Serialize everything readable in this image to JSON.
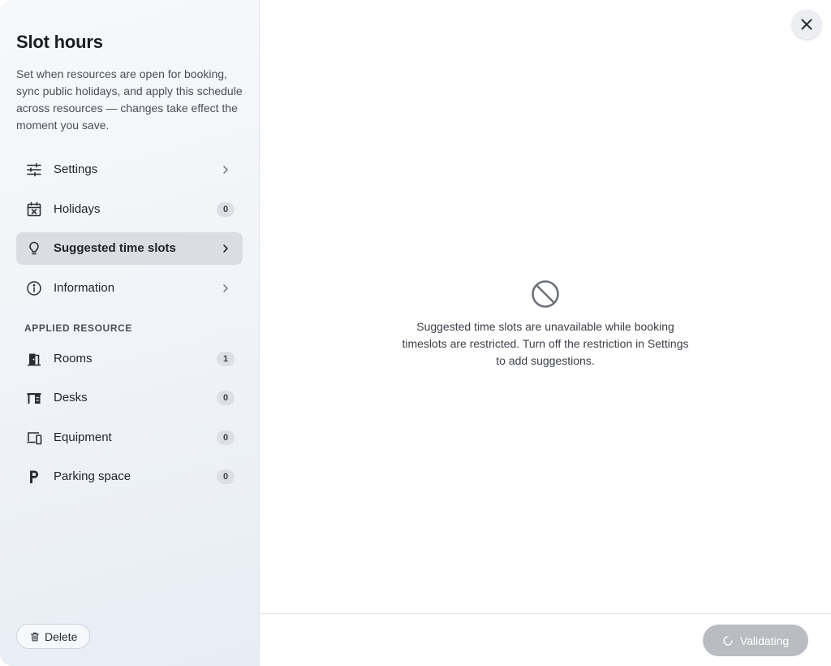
{
  "sidebar": {
    "title": "Slot hours",
    "description": "Set when resources are open for booking, sync public holidays, and apply this schedule across resources — changes take effect the moment you save.",
    "nav": [
      {
        "label": "Settings",
        "icon": "sliders-icon"
      },
      {
        "label": "Holidays",
        "icon": "calendar-x-icon",
        "badge": "0"
      },
      {
        "label": "Suggested time slots",
        "icon": "lightbulb-icon",
        "active": true
      },
      {
        "label": "Information",
        "icon": "info-icon"
      }
    ],
    "applied_section_label": "APPLIED RESOURCE",
    "resources": [
      {
        "label": "Rooms",
        "icon": "door-icon",
        "badge": "1"
      },
      {
        "label": "Desks",
        "icon": "desk-icon",
        "badge": "0"
      },
      {
        "label": "Equipment",
        "icon": "devices-icon",
        "badge": "0"
      },
      {
        "label": "Parking space",
        "icon": "parking-icon",
        "badge": "0"
      }
    ],
    "delete_label": "Delete"
  },
  "main": {
    "empty_message": "Suggested time slots are unavailable while booking timeslots are restricted. Turn off the restriction in Settings to add suggestions.",
    "validate_label": "Validating"
  },
  "colors": {
    "active_item_bg": "#dadde2",
    "validate_btn_bg": "#b9bcc1",
    "badge_bg": "#dcdfe4"
  }
}
